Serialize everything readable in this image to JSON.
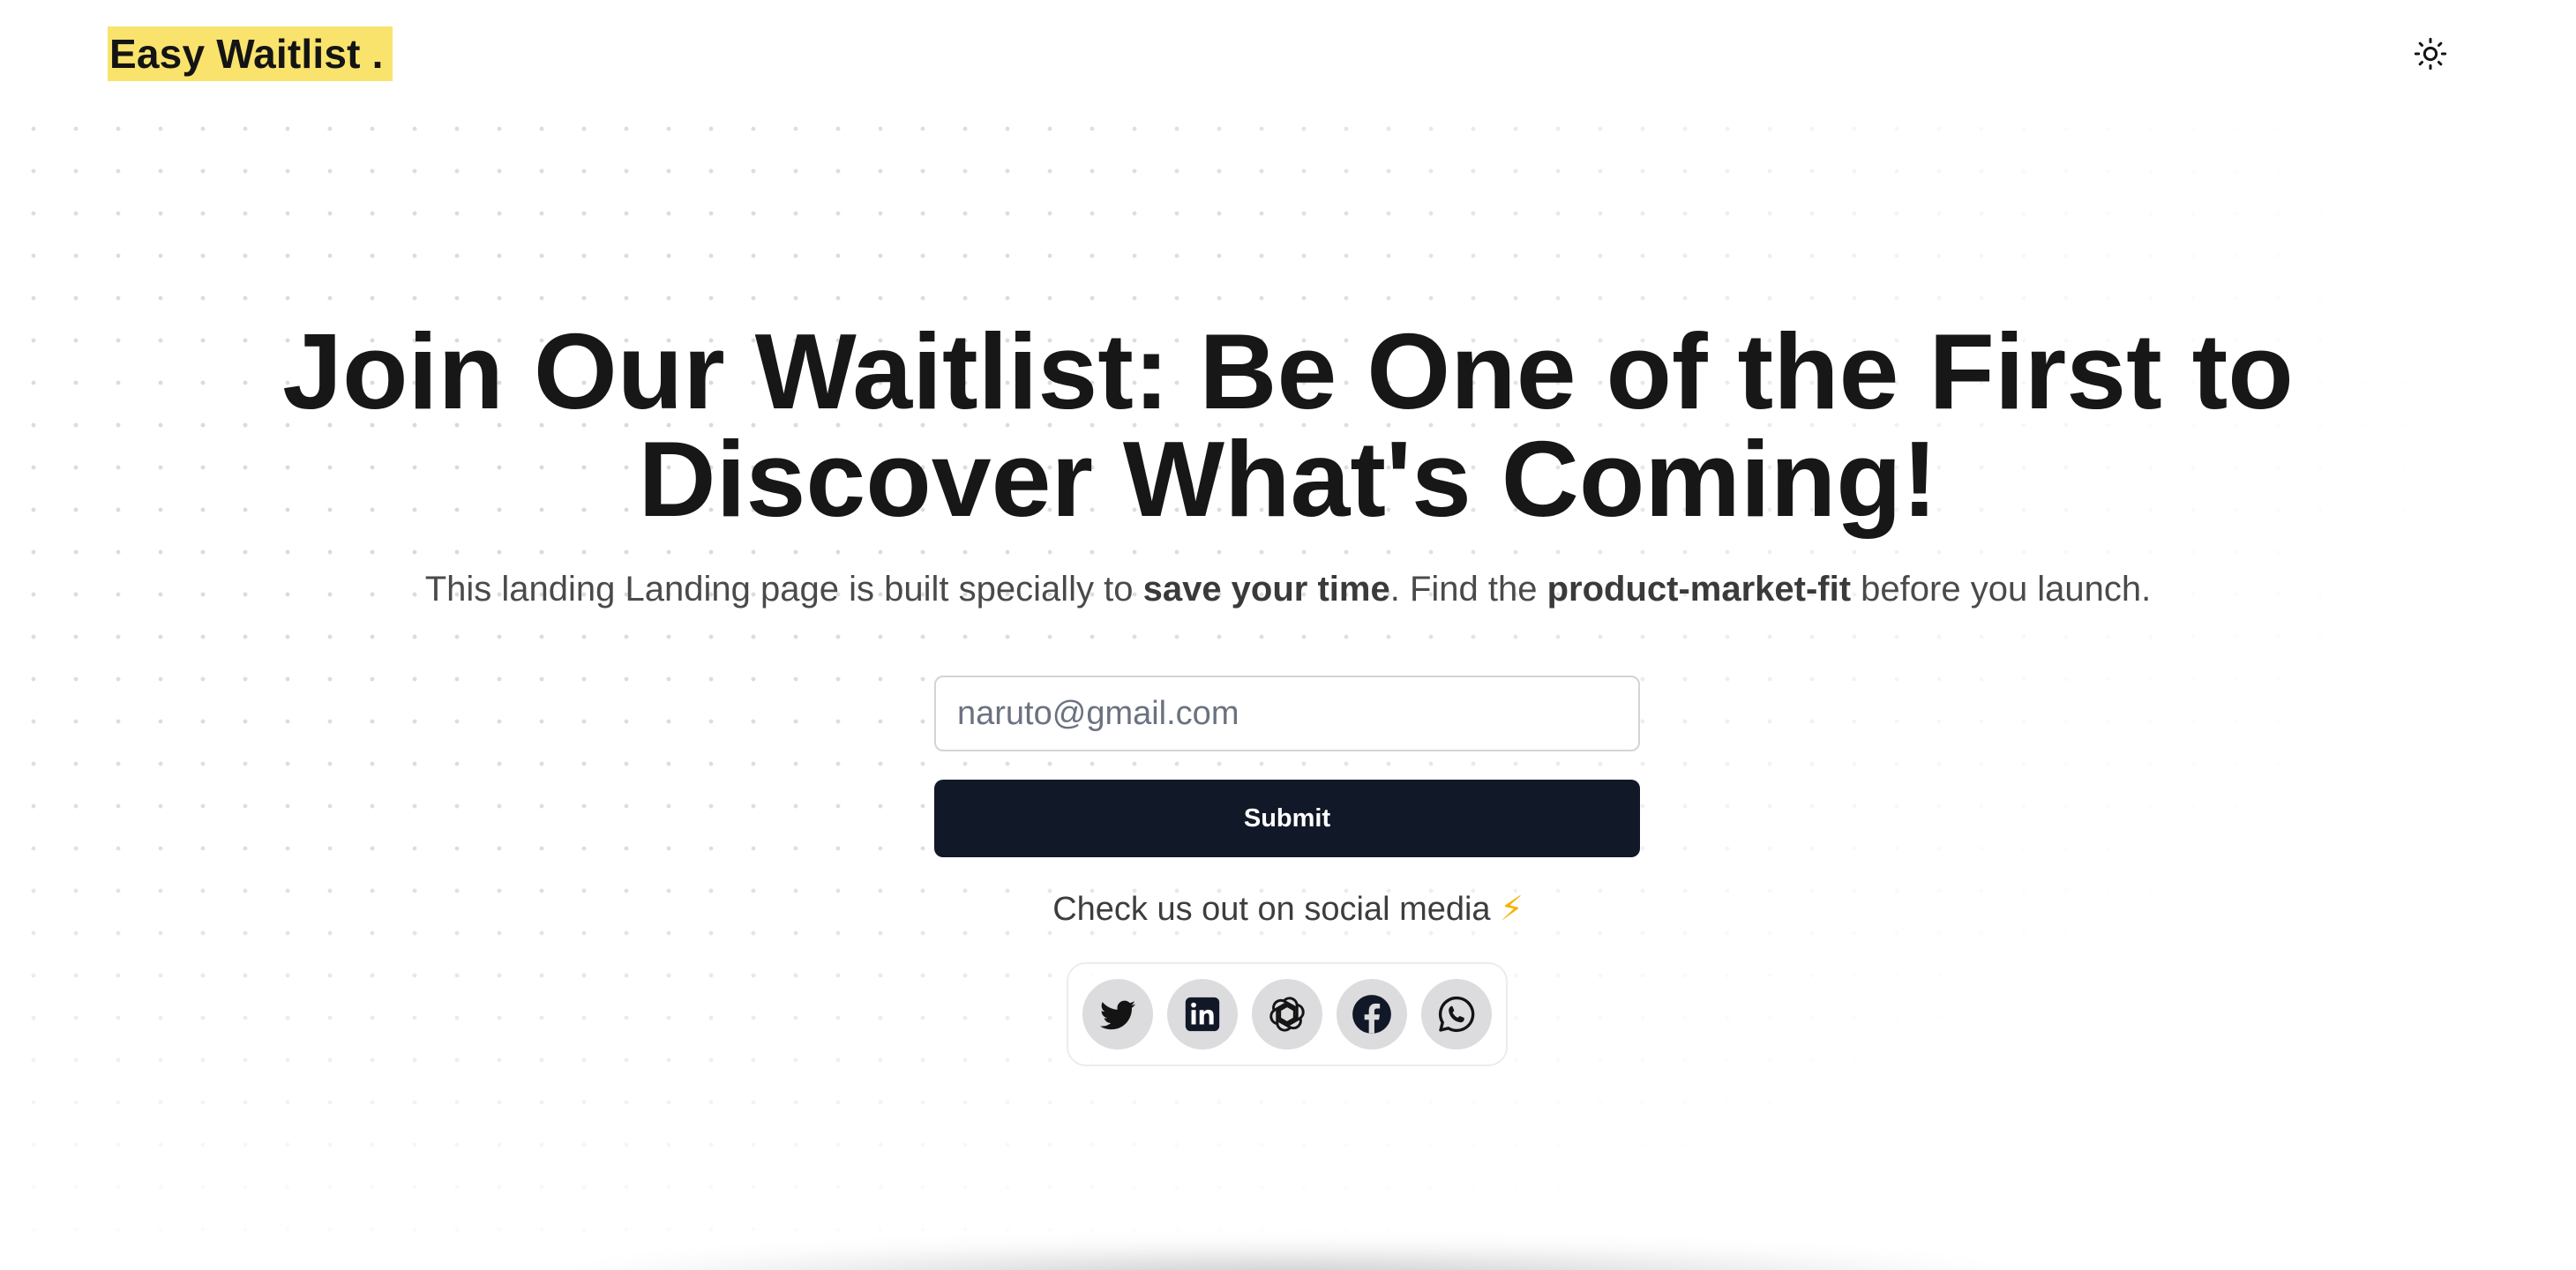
{
  "header": {
    "logo_text": "Easy Waitlist .",
    "theme_toggle_icon": "sun-icon"
  },
  "hero": {
    "headline_line1": "Join Our Waitlist: Be One of the First to",
    "headline_line2": "Discover What's Coming!",
    "subtitle_part1": "This landing Landing page is built specially to ",
    "subtitle_bold1": "save your time",
    "subtitle_part2": ". Find the ",
    "subtitle_bold2": "product-market-fit",
    "subtitle_part3": " before you launch."
  },
  "form": {
    "email_placeholder": "naruto@gmail.com",
    "email_value": "",
    "submit_label": "Submit"
  },
  "social": {
    "caption": "Check us out on social media",
    "caption_emoji": "⚡",
    "icons": [
      "twitter-icon",
      "linkedin-icon",
      "openai-icon",
      "facebook-icon",
      "whatsapp-icon"
    ]
  },
  "colors": {
    "logo_highlight": "#f9e36c",
    "button_bg": "#111827",
    "icon_circle": "#dcdcdf",
    "text_primary": "#171717"
  }
}
